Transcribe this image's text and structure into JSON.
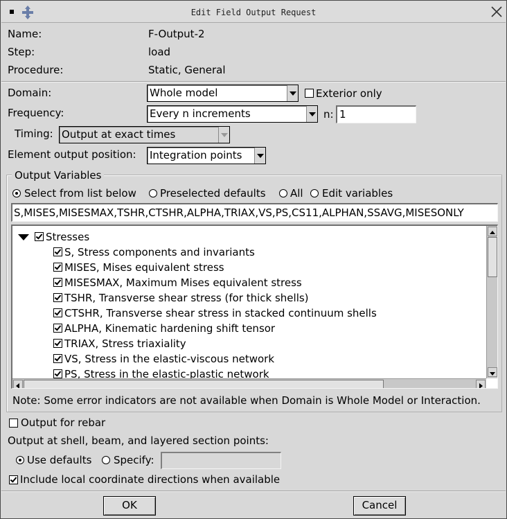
{
  "window": {
    "title": "Edit Field Output Request"
  },
  "info": {
    "name_label": "Name:",
    "name_value": "F-Output-2",
    "step_label": "Step:",
    "step_value": "load",
    "procedure_label": "Procedure:",
    "procedure_value": "Static, General"
  },
  "domain": {
    "label": "Domain:",
    "value": "Whole model",
    "exterior_label": "Exterior only",
    "exterior_checked": false
  },
  "frequency": {
    "label": "Frequency:",
    "value": "Every n increments",
    "n_label": "n:",
    "n_value": "1"
  },
  "timing": {
    "label": "Timing:",
    "value": "Output at exact times"
  },
  "element_position": {
    "label": "Element output position:",
    "value": "Integration points"
  },
  "output_variables": {
    "group_label": "Output Variables",
    "radios": [
      {
        "label": "Select from list below",
        "selected": true
      },
      {
        "label": "Preselected defaults",
        "selected": false
      },
      {
        "label": "All",
        "selected": false
      },
      {
        "label": "Edit variables",
        "selected": false
      }
    ],
    "variables_text": "S,MISES,MISESMAX,TSHR,CTSHR,ALPHA,TRIAX,VS,PS,CS11,ALPHAN,SSAVG,MISESONLY",
    "tree": {
      "category": "Stresses",
      "items": [
        "S, Stress components and invariants",
        "MISES, Mises equivalent stress",
        "MISESMAX, Maximum Mises equivalent stress",
        "TSHR, Transverse shear stress (for thick shells)",
        "CTSHR, Transverse shear stress in stacked continuum shells",
        "ALPHA, Kinematic hardening shift tensor",
        "TRIAX, Stress triaxiality",
        "VS, Stress in the elastic-viscous network",
        "PS, Stress in the elastic-plastic network"
      ]
    },
    "note": "Note:  Some error indicators are not available when Domain is Whole Model or Interaction."
  },
  "rebar": {
    "label": "Output for rebar",
    "checked": false
  },
  "section_points": {
    "label": "Output at shell, beam, and layered section points:",
    "use_defaults_label": "Use defaults",
    "specify_label": "Specify:",
    "specify_value": ""
  },
  "local_coords": {
    "label": "Include local coordinate directions when available",
    "checked": true
  },
  "buttons": {
    "ok": "OK",
    "cancel": "Cancel"
  }
}
